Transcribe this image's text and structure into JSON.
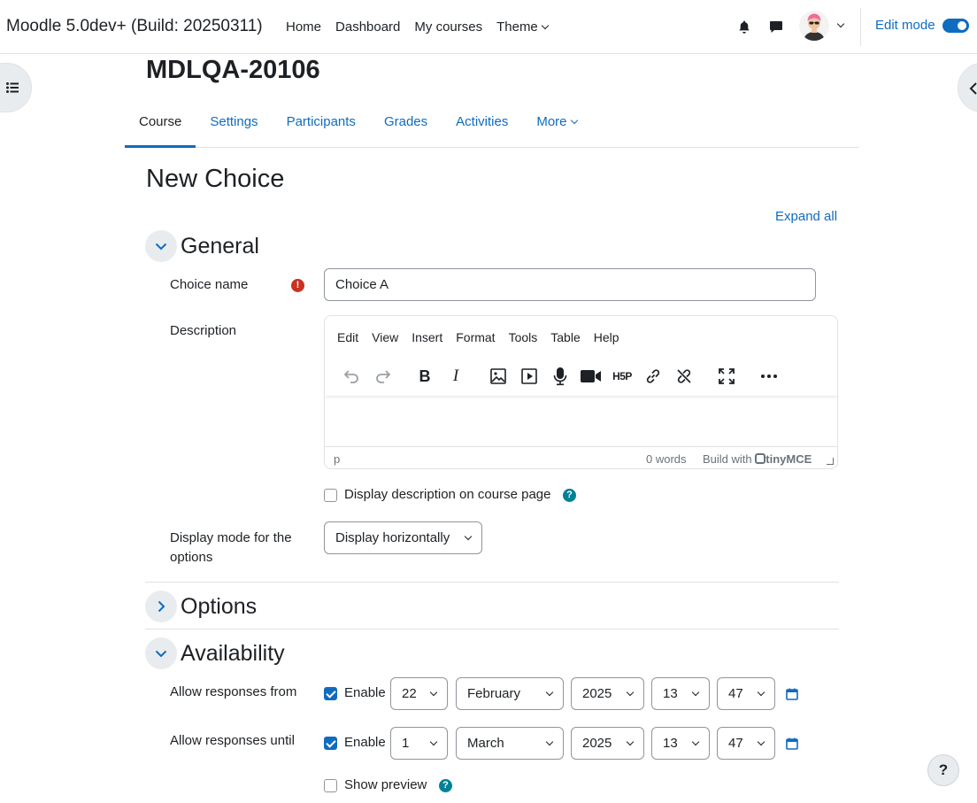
{
  "brand": "Moodle 5.0dev+ (Build: 20250311)",
  "primary_nav": [
    "Home",
    "Dashboard",
    "My courses",
    "Theme"
  ],
  "edit_mode_label": "Edit mode",
  "course": {
    "title": "MDLQA-20106",
    "tabs": [
      "Course",
      "Settings",
      "Participants",
      "Grades",
      "Activities",
      "More"
    ],
    "active_tab": "Course"
  },
  "page_heading": "New Choice",
  "expand_all": "Expand all",
  "sections": {
    "general": "General",
    "options": "Options",
    "availability": "Availability"
  },
  "form": {
    "choice_name_label": "Choice name",
    "choice_name_value": "Choice A",
    "description_label": "Description",
    "editor_menu": [
      "Edit",
      "View",
      "Insert",
      "Format",
      "Tools",
      "Table",
      "Help"
    ],
    "editor_status_path": "p",
    "editor_word_count": "0 words",
    "editor_build_with": "Build with",
    "editor_brand": "tinyMCE",
    "display_description_label": "Display description on course page",
    "display_description_checked": false,
    "display_mode_label": "Display mode for the options",
    "display_mode_value": "Display horizontally",
    "allow_from_label": "Allow responses from",
    "allow_from": {
      "enable_label": "Enable",
      "enabled": true,
      "day": "22",
      "month": "February",
      "year": "2025",
      "hour": "13",
      "minute": "47"
    },
    "allow_until_label": "Allow responses until",
    "allow_until": {
      "enable_label": "Enable",
      "enabled": true,
      "day": "1",
      "month": "March",
      "year": "2025",
      "hour": "13",
      "minute": "47"
    },
    "show_preview_label": "Show preview",
    "show_preview_checked": false
  },
  "help_fab": "?",
  "colors": {
    "primary": "#0f6cbf",
    "required": "#ca3120",
    "help": "#008196",
    "text": "#1d2125"
  }
}
